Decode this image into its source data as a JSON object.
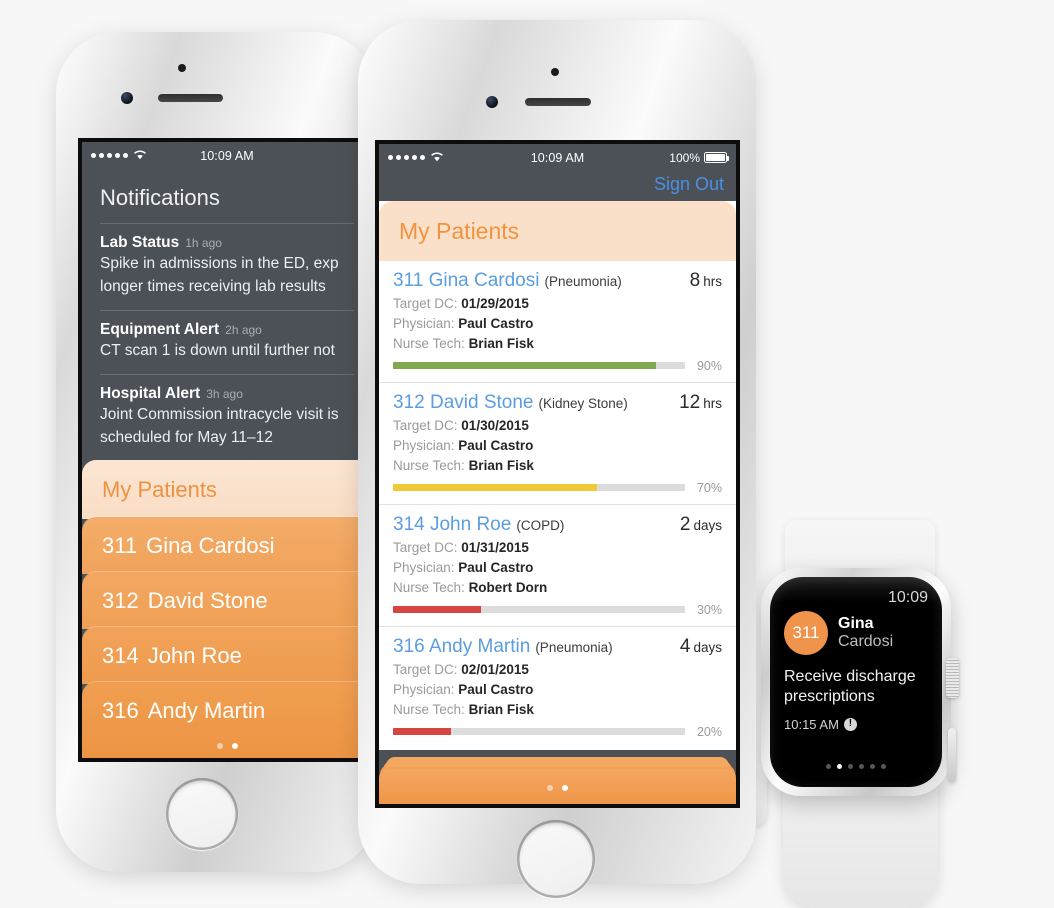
{
  "status_bar": {
    "carrier_dots": 5,
    "wifi_icon": "wifi-icon",
    "time": "10:09 AM",
    "battery_percent": "100%"
  },
  "left_phone": {
    "notifications_title": "Notifications",
    "items": [
      {
        "title": "Lab Status",
        "ago": "1h ago",
        "body_line1": "Spike in admissions in the ED, exp",
        "body_line2": "longer times receiving lab results"
      },
      {
        "title": "Equipment Alert",
        "ago": "2h ago",
        "body_line1": "CT scan 1 is down until further not",
        "body_line2": ""
      },
      {
        "title": "Hospital Alert",
        "ago": "3h ago",
        "body_line1": "Joint Commission intracycle visit is",
        "body_line2": "scheduled for May 11–12"
      }
    ],
    "card_header": "My Patients",
    "patients": [
      {
        "room": "311",
        "name": "Gina Cardosi"
      },
      {
        "room": "312",
        "name": "David Stone"
      },
      {
        "room": "314",
        "name": "John Roe"
      },
      {
        "room": "316",
        "name": "Andy Martin"
      }
    ],
    "page_dots": {
      "count": 2,
      "active_index": 1
    }
  },
  "right_phone": {
    "sign_out": "Sign Out",
    "header": "My Patients",
    "labels": {
      "target_dc": "Target DC:",
      "physician": "Physician:",
      "nurse_tech": "Nurse Tech:"
    },
    "patients": [
      {
        "room": "311",
        "name": "Gina Cardosi",
        "diagnosis": "(Pneumonia)",
        "time_value": "8",
        "time_unit": "hrs",
        "target_dc": "01/29/2015",
        "physician": "Paul Castro",
        "nurse_tech": "Brian Fisk",
        "progress": 90,
        "progress_label": "90%",
        "progress_color": "#7fa84f"
      },
      {
        "room": "312",
        "name": "David Stone",
        "diagnosis": "(Kidney Stone)",
        "time_value": "12",
        "time_unit": "hrs",
        "target_dc": "01/30/2015",
        "physician": "Paul Castro",
        "nurse_tech": "Brian Fisk",
        "progress": 70,
        "progress_label": "70%",
        "progress_color": "#f0c939"
      },
      {
        "room": "314",
        "name": "John Roe",
        "diagnosis": "(COPD)",
        "time_value": "2",
        "time_unit": "days",
        "target_dc": "01/31/2015",
        "physician": "Paul Castro",
        "nurse_tech": "Robert Dorn",
        "progress": 30,
        "progress_label": "30%",
        "progress_color": "#d64541"
      },
      {
        "room": "316",
        "name": "Andy Martin",
        "diagnosis": "(Pneumonia)",
        "time_value": "4",
        "time_unit": "days",
        "target_dc": "02/01/2015",
        "physician": "Paul Castro",
        "nurse_tech": "Brian Fisk",
        "progress": 20,
        "progress_label": "20%",
        "progress_color": "#d64541"
      }
    ],
    "page_dots": {
      "count": 2,
      "active_index": 1
    }
  },
  "watch": {
    "time": "10:09",
    "badge_room": "311",
    "first_name": "Gina",
    "last_name": "Cardosi",
    "message": "Receive discharge prescriptions",
    "timestamp": "10:15 AM",
    "alert_icon": "exclamation-icon",
    "page_dots": {
      "count": 6,
      "active_index": 1
    }
  },
  "colors": {
    "dark_chrome": "#4c5157",
    "orange_accent": "#f2943f",
    "orange_header_bg": "#fae0c8",
    "link_blue": "#5a9de0",
    "signout_blue": "#4a90e2",
    "green": "#7fa84f",
    "yellow": "#f0c939",
    "red": "#d64541"
  }
}
